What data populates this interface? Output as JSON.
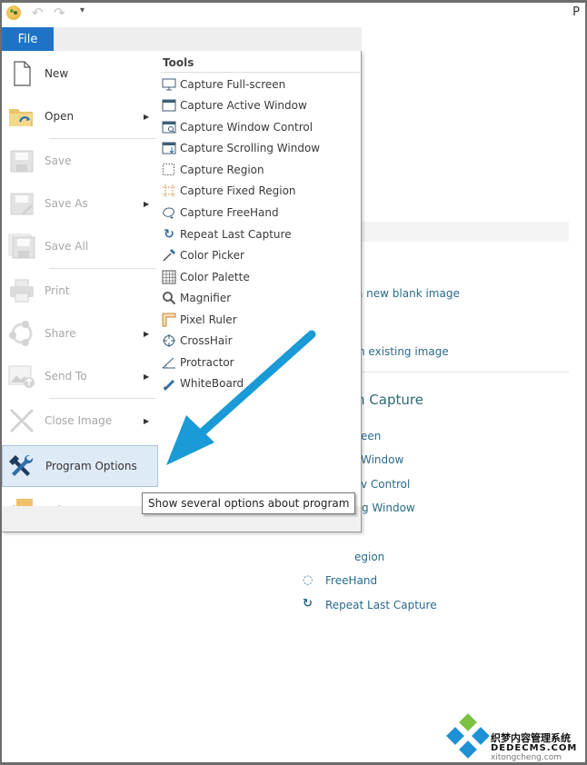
{
  "window": {
    "title_fragment": "P",
    "qat": {
      "app_icon": "app-logo-icon",
      "undo_icon": "undo-icon",
      "redo_icon": "redo-icon",
      "customize_icon": "chevron-down-icon"
    }
  },
  "ribbon": {
    "file_tab_label": "File"
  },
  "file_menu": {
    "items": [
      {
        "label": "New",
        "icon": "new-document-icon",
        "enabled": true,
        "submenu": false
      },
      {
        "label": "Open",
        "icon": "open-folder-icon",
        "enabled": true,
        "submenu": true
      },
      {
        "label": "Save",
        "icon": "save-icon",
        "enabled": false,
        "submenu": false
      },
      {
        "label": "Save As",
        "icon": "save-as-icon",
        "enabled": false,
        "submenu": true
      },
      {
        "label": "Save All",
        "icon": "save-all-icon",
        "enabled": false,
        "submenu": false
      },
      {
        "label": "Print",
        "icon": "printer-icon",
        "enabled": false,
        "submenu": false
      },
      {
        "label": "Share",
        "icon": "share-icon",
        "enabled": false,
        "submenu": true
      },
      {
        "label": "Send To",
        "icon": "send-to-icon",
        "enabled": false,
        "submenu": true
      },
      {
        "label": "Close Image",
        "icon": "close-icon",
        "enabled": false,
        "submenu": true
      },
      {
        "label": "Program Options",
        "icon": "wrench-screwdriver-icon",
        "enabled": true,
        "submenu": false,
        "highlighted": true
      },
      {
        "label": "Exit",
        "icon": "exit-icon",
        "enabled": true,
        "submenu": false
      }
    ],
    "tools": {
      "title": "Tools",
      "items": [
        {
          "label": "Capture Full-screen",
          "icon": "monitor-icon"
        },
        {
          "label": "Capture Active Window",
          "icon": "window-icon"
        },
        {
          "label": "Capture Window Control",
          "icon": "window-search-icon"
        },
        {
          "label": "Capture Scrolling Window",
          "icon": "scrolling-window-icon"
        },
        {
          "label": "Capture Region",
          "icon": "region-icon"
        },
        {
          "label": "Capture Fixed Region",
          "icon": "fixed-region-icon"
        },
        {
          "label": "Capture FreeHand",
          "icon": "freehand-icon"
        },
        {
          "label": "Repeat Last Capture",
          "icon": "repeat-icon"
        },
        {
          "label": "Color Picker",
          "icon": "eyedropper-icon"
        },
        {
          "label": "Color Palette",
          "icon": "palette-grid-icon"
        },
        {
          "label": "Magnifier",
          "icon": "magnifier-icon"
        },
        {
          "label": "Pixel Ruler",
          "icon": "ruler-icon"
        },
        {
          "label": "CrossHair",
          "icon": "crosshair-icon"
        },
        {
          "label": "Protractor",
          "icon": "protractor-icon"
        },
        {
          "label": "WhiteBoard",
          "icon": "pen-icon"
        }
      ]
    }
  },
  "tooltip": {
    "text": "Show several options about program"
  },
  "background_page": {
    "links": {
      "new_blank": "a new blank image",
      "open_existing": "n existing image"
    },
    "capture_heading": "n Capture",
    "capture_items": [
      "een",
      "Window",
      "v Control",
      "g Window",
      "egion",
      "FreeHand",
      "Repeat Last Capture"
    ]
  },
  "annotation": {
    "arrow_color": "#1a9ad6"
  },
  "watermark": {
    "line1": "织梦内容管理系统",
    "line2": "DEDECMS.COM",
    "line3": "xitongcheng.com"
  },
  "colors": {
    "accent": "#1e73c9",
    "highlight": "#dfeaf7",
    "disabled_text": "#a8a8a8"
  }
}
